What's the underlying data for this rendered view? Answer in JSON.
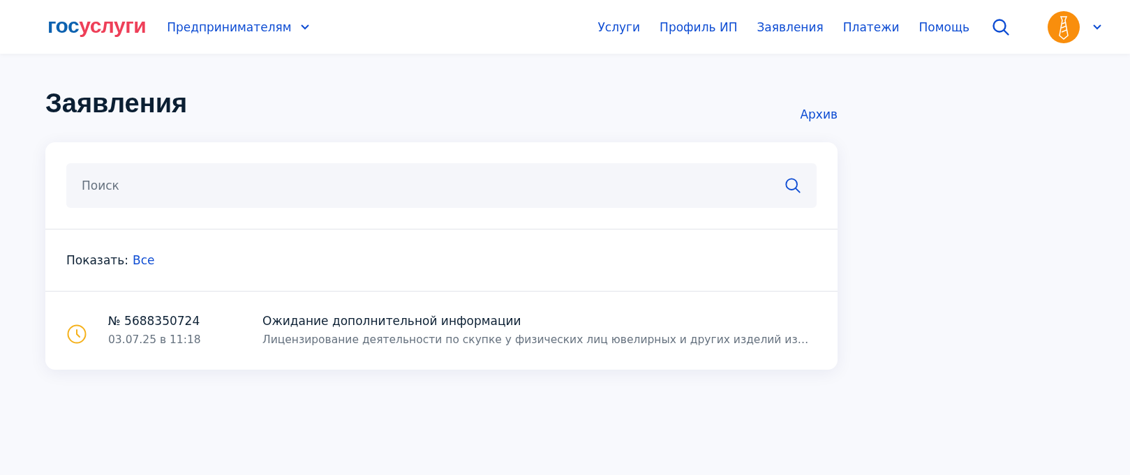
{
  "header": {
    "logo": {
      "part_1": "гос",
      "part_2": "услуги"
    },
    "section_menu": "Предпринимателям",
    "nav": [
      "Услуги",
      "Профиль ИП",
      "Заявления",
      "Платежи",
      "Помощь"
    ]
  },
  "page": {
    "title": "Заявления",
    "archive_link": "Архив"
  },
  "search": {
    "placeholder": "Поиск"
  },
  "filter": {
    "label": "Показать:",
    "value": "Все"
  },
  "applications": [
    {
      "color": "#f5b11b",
      "number": "№ 5688350724",
      "date": "03.07.25 в 11:18",
      "title": "Ожидание дополнительной информации",
      "description": "Лицензирование деятельности по скупке у физических лиц ювелирных и других изделий из…"
    }
  ]
}
